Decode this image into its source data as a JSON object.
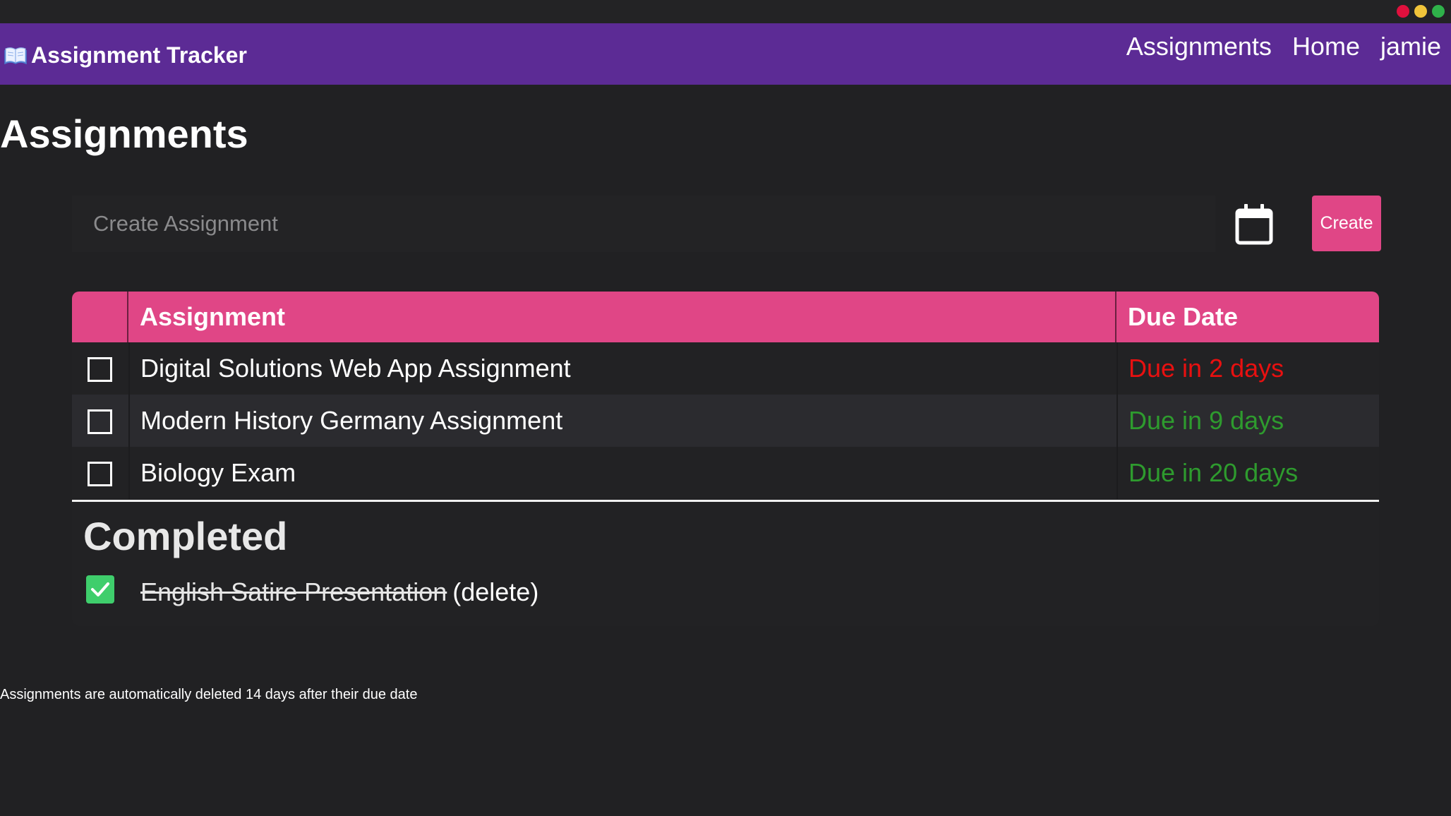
{
  "window": {
    "controls": [
      "close",
      "minimize",
      "maximize"
    ]
  },
  "colors": {
    "nav_bg": "#5c2b95",
    "accent": "#e04686",
    "due_soon": "#e81010",
    "due_later": "#2e9b2e",
    "completed_check": "#3fce6c",
    "traffic_red": "#e0103d",
    "traffic_yellow": "#f0c43a",
    "traffic_green": "#2fb24a"
  },
  "nav": {
    "brand_icon": "open-book-icon",
    "brand": "Assignment Tracker",
    "links": [
      "Assignments",
      "Home",
      "jamie"
    ]
  },
  "page": {
    "title": "Assignments"
  },
  "create": {
    "placeholder": "Create Assignment",
    "calendar_icon": "calendar-icon",
    "button_label": "Create"
  },
  "table": {
    "headers": {
      "check": "",
      "assignment": "Assignment",
      "due": "Due Date"
    },
    "rows": [
      {
        "checked": false,
        "title": "Digital Solutions Web App Assignment",
        "due": "Due in 2 days",
        "status": "due_soon"
      },
      {
        "checked": false,
        "title": "Modern History Germany Assignment",
        "due": "Due in 9 days",
        "status": "due_later"
      },
      {
        "checked": false,
        "title": "Biology Exam",
        "due": "Due in 20 days",
        "status": "due_later"
      }
    ]
  },
  "completed": {
    "heading": "Completed",
    "items": [
      {
        "checked": true,
        "title": "English Satire Presentation",
        "delete_label": "(delete)"
      }
    ]
  },
  "footer": {
    "note": "Assignments are automatically deleted 14 days after their due date"
  }
}
